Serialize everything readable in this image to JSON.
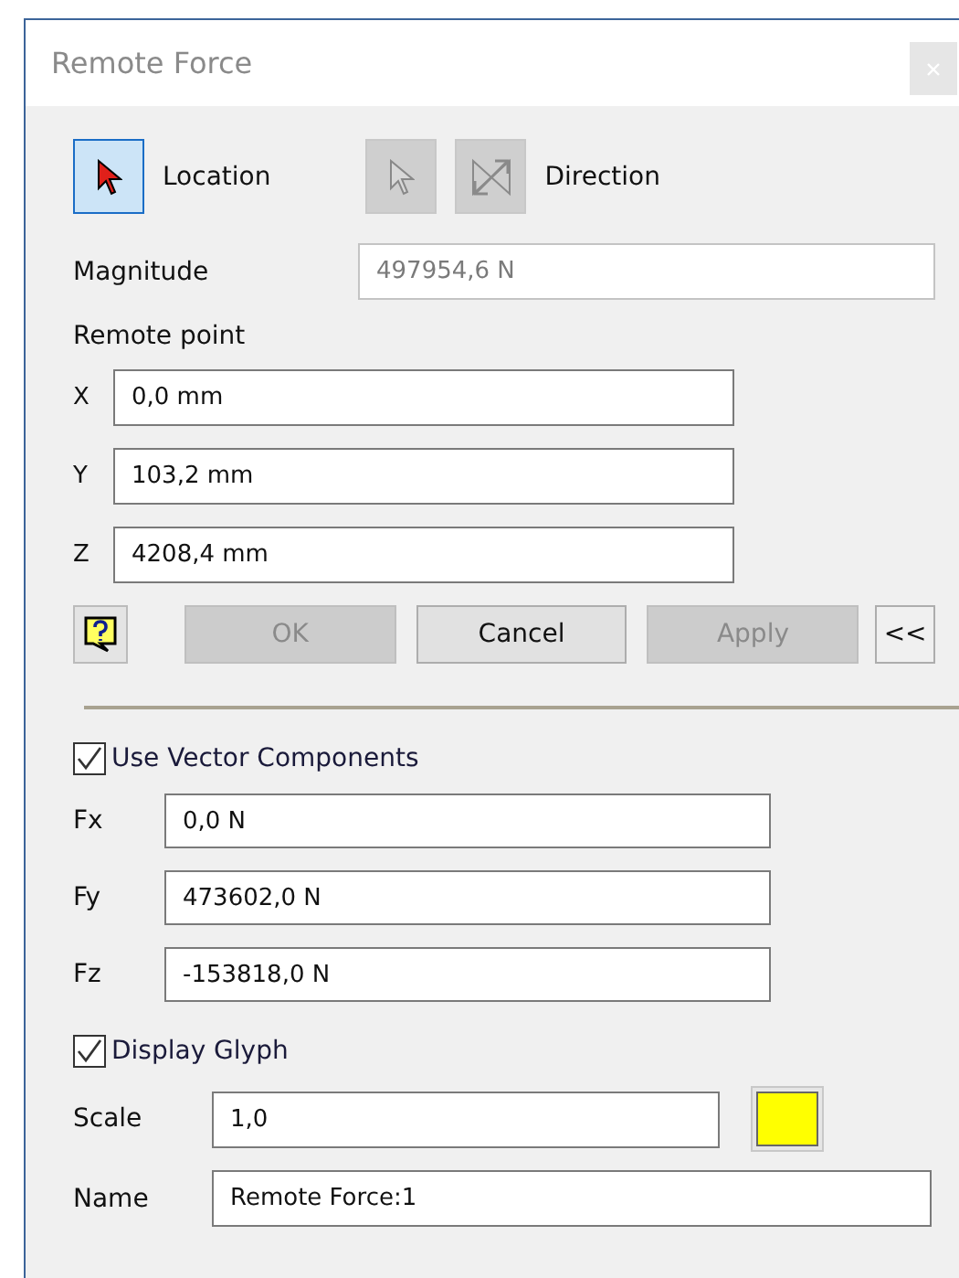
{
  "window": {
    "title": "Remote Force"
  },
  "mode_buttons": [
    {
      "kind": "location",
      "selected": true,
      "disabled": false
    },
    {
      "kind": "direction-pick",
      "selected": false,
      "disabled": true
    },
    {
      "kind": "direction-flip",
      "selected": false,
      "disabled": true
    }
  ],
  "location_label": "Location",
  "direction_label": "Direction",
  "magnitude": {
    "label": "Magnitude",
    "value": "497954,6 N",
    "disabled": true
  },
  "remote_point": {
    "label": "Remote point",
    "fields": [
      {
        "label": "X",
        "value": "0,0 mm"
      },
      {
        "label": "Y",
        "value": "103,2 mm"
      },
      {
        "label": "Z",
        "value": "4208,4 mm"
      }
    ]
  },
  "buttons": [
    {
      "label": "OK",
      "disabled": true
    },
    {
      "label": "Cancel",
      "disabled": false
    },
    {
      "label": "Apply",
      "disabled": true
    }
  ],
  "collapse_button": "<<",
  "use_vector": {
    "label": "Use Vector Components",
    "checked": true
  },
  "components": [
    {
      "label": "Fx",
      "value": "0,0 N"
    },
    {
      "label": "Fy",
      "value": "473602,0 N"
    },
    {
      "label": "Fz",
      "value": "-153818,0 N"
    }
  ],
  "display_glyph": {
    "label": "Display Glyph",
    "checked": true
  },
  "scale": {
    "label": "Scale",
    "value": "1,0",
    "color": "#ffff00"
  },
  "name": {
    "label": "Name",
    "value": "Remote Force:1"
  }
}
